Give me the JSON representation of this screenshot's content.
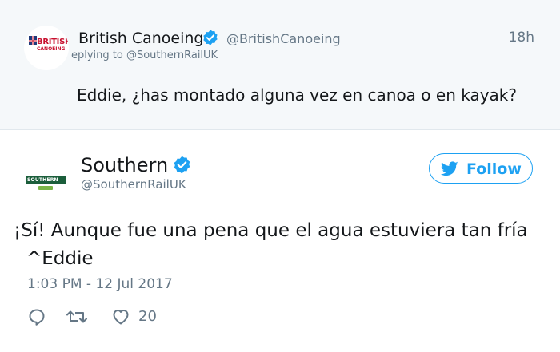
{
  "parent_tweet": {
    "author": {
      "name": "British Canoeing",
      "handle": "@BritishCanoeing",
      "verified": true,
      "logo_text": "BRITISH",
      "logo_subtext": "CANOEING"
    },
    "time": "18h",
    "replying_to": "eplying to @SouthernRailUK",
    "text": "Eddie, ¿has montado alguna vez en canoa o en kayak?"
  },
  "main_tweet": {
    "author": {
      "name": "Southern",
      "handle": "@SouthernRailUK",
      "verified": true,
      "logo_text": "SOUTHERN"
    },
    "follow_label": "Follow",
    "text_line1": "¡Sí! Aunque fue una pena que el agua estuviera tan fría",
    "text_line2": "^Eddie",
    "timestamp": "1:03 PM - 12 Jul 2017",
    "actions": {
      "reply_icon": "reply-icon",
      "retweet_icon": "retweet-icon",
      "like_icon": "heart-icon",
      "like_count": "20"
    }
  },
  "colors": {
    "twitter_blue": "#1da1f2",
    "text_primary": "#14171a",
    "text_secondary": "#657786",
    "parent_background": "#f5f8fa",
    "british_canoeing_red": "#c8102e",
    "southern_green": "#1b5e3b",
    "southern_light_green": "#7ab648"
  }
}
